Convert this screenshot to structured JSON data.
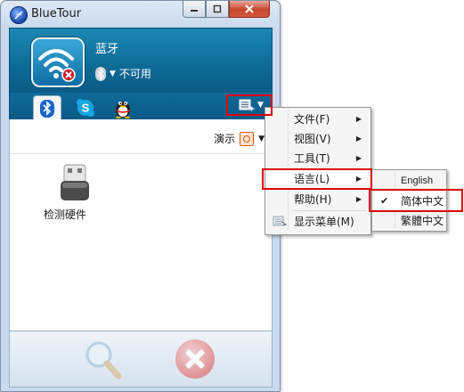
{
  "window": {
    "title": "BlueTour",
    "controls": {
      "minimize": "—",
      "restore": "□",
      "close": "✕"
    }
  },
  "device": {
    "name": "蓝牙",
    "status": "不可用"
  },
  "tabs": [
    {
      "name": "bluetooth",
      "icon": "bluetooth-icon"
    },
    {
      "name": "skype",
      "icon": "skype-icon"
    },
    {
      "name": "qq",
      "icon": "qq-penguin-icon"
    }
  ],
  "toolbar": {
    "demo_label": "演示",
    "menu_button_icon": "menu-list-icon"
  },
  "items": [
    {
      "label": "检测硬件",
      "icon": "usb-drive-icon"
    }
  ],
  "menu": {
    "items": [
      {
        "label": "文件(F)",
        "has_submenu": true
      },
      {
        "label": "视图(V)",
        "has_submenu": true
      },
      {
        "label": "工具(T)",
        "has_submenu": true
      },
      {
        "label": "语言(L)",
        "has_submenu": true
      },
      {
        "label": "帮助(H)",
        "has_submenu": true
      },
      {
        "label": "显示菜单(M)",
        "has_submenu": false
      }
    ]
  },
  "language_submenu": {
    "items": [
      {
        "label": "English",
        "checked": false
      },
      {
        "label": "简体中文",
        "checked": true
      },
      {
        "label": "繁體中文",
        "checked": false
      }
    ]
  },
  "colors": {
    "header_blue": "#0e6a95",
    "highlight_red": "#e00000",
    "menu_bg": "#f5f5f5"
  }
}
